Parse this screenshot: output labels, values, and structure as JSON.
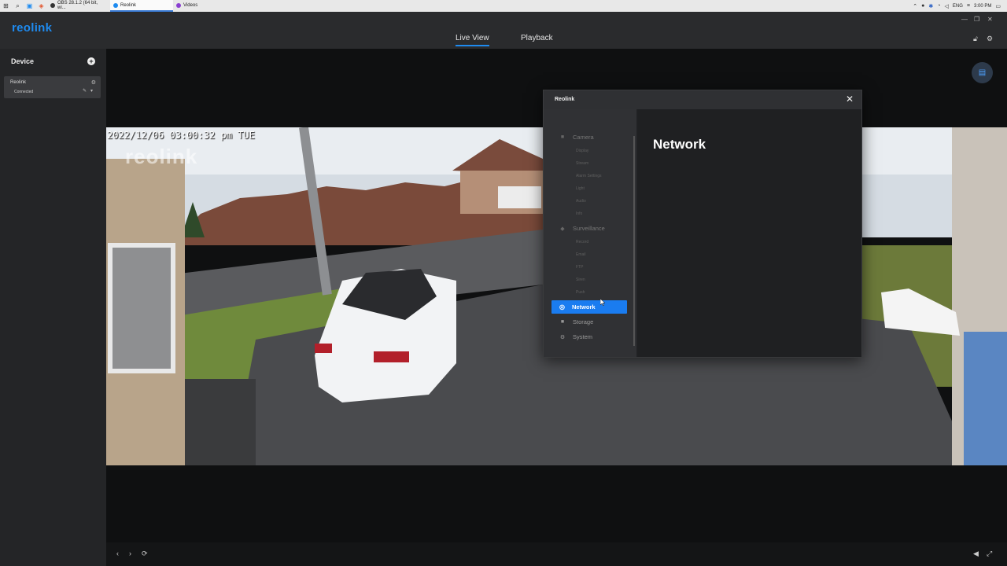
{
  "taskbar": {
    "tasks": [
      {
        "label": "OBS 28.1.2 (64 bit, wi...",
        "color": "#333333"
      },
      {
        "label": "Reolink",
        "color": "#1e8bf0"
      },
      {
        "label": "Videos",
        "color": "#8a3fd1"
      }
    ],
    "tray": {
      "lang": "ENG",
      "time": "3:00 PM"
    }
  },
  "app": {
    "logo": "reolink",
    "nav": {
      "live_view": "Live View",
      "playback": "Playback"
    },
    "accent": "#1e8bf0"
  },
  "sidebar": {
    "title": "Device",
    "device": {
      "name": "Reolink",
      "status": "Connected"
    }
  },
  "camera": {
    "osd_timestamp": "2022/12/06 03:00:32 pm TUE",
    "osd_logo": "reolink"
  },
  "dialog": {
    "title": "Reolink",
    "heading": "Network",
    "menu": {
      "camera": {
        "label": "Camera",
        "items": [
          "Display",
          "Stream",
          "Alarm Settings",
          "Light",
          "Audio",
          "Info"
        ]
      },
      "surveillance": {
        "label": "Surveillance",
        "items": [
          "Record",
          "Email",
          "FTP",
          "Siren",
          "Push"
        ]
      },
      "network": "Network",
      "storage": "Storage",
      "system": "System"
    }
  }
}
